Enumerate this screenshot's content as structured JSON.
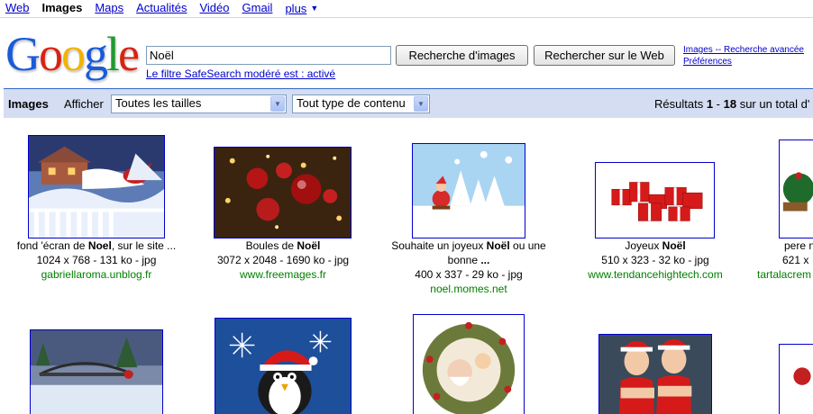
{
  "nav": {
    "items": [
      "Web",
      "Images",
      "Maps",
      "Actualités",
      "Vidéo",
      "Gmail"
    ],
    "current": "Images",
    "more": "plus"
  },
  "logo": "Google",
  "search": {
    "value": "Noël",
    "btn_images": "Recherche d'images",
    "btn_web": "Rechercher sur le Web",
    "link_advanced": "Images -- Recherche avancée",
    "link_prefs": "Préférences",
    "safesearch": "Le filtre SafeSearch modéré est : activé"
  },
  "bar": {
    "title": "Images",
    "show_label": "Afficher",
    "size_select": "Toutes les tailles",
    "type_select": "Tout type de contenu",
    "results_prefix": "Résultats ",
    "results_from": "1",
    "results_sep": " - ",
    "results_to": "18",
    "results_suffix": " sur un total d'"
  },
  "results_row1": [
    {
      "caption_pre": "fond 'écran de ",
      "caption_bold": "Noel",
      "caption_post": ", sur le site ...",
      "size": "1024 x 768 - 131 ko - jpg",
      "source": "gabriellaroma.unblog.fr"
    },
    {
      "caption_pre": "Boules de ",
      "caption_bold": "Noël",
      "caption_post": "",
      "size": "3072 x 2048 - 1690 ko - jpg",
      "source": "www.freemages.fr"
    },
    {
      "caption_pre": "Souhaite un joyeux ",
      "caption_bold": "Noël",
      "caption_post": " ou une",
      "caption_line2_pre": "bonne ",
      "caption_line2_bold": "...",
      "size": "400 x 337 - 29 ko - jpg",
      "source": "noel.momes.net"
    },
    {
      "caption_pre": "Joyeux ",
      "caption_bold": "Noël",
      "caption_post": "",
      "size": "510 x 323 - 32 ko - jpg",
      "source": "www.tendancehightech.com"
    },
    {
      "caption_pre": "pere n",
      "caption_bold": "",
      "caption_post": "",
      "size": "621 x",
      "source": "tartalacrem"
    }
  ]
}
